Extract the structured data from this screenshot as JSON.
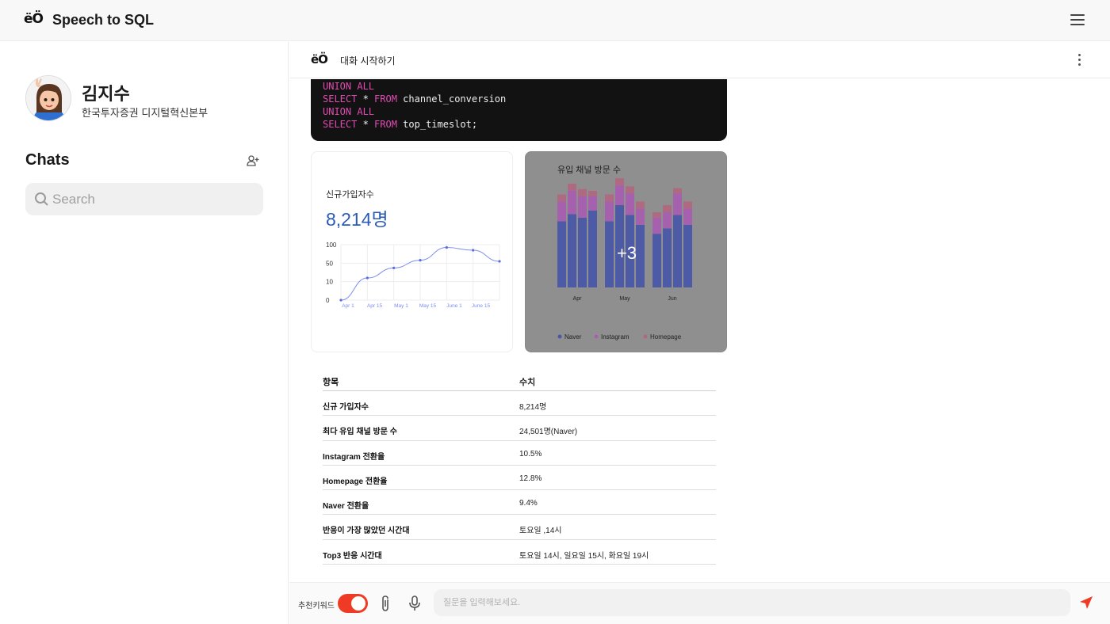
{
  "app": {
    "logo_text": "ëÖ",
    "title": "Speech to SQL"
  },
  "user": {
    "name": "김지수",
    "org": "한국투자증권 디지털혁신본부"
  },
  "sidebar": {
    "chats_title": "Chats",
    "search_placeholder": "Search"
  },
  "chat": {
    "header_label": "대화 시작하기"
  },
  "code": {
    "lines": [
      {
        "kw": "UNION ALL",
        "rest": ""
      },
      {
        "kw": "SELECT",
        "rest": " * ",
        "kw2": "FROM",
        "rest2": " channel_conversion"
      },
      {
        "kw": "UNION ALL",
        "rest": ""
      },
      {
        "kw": "SELECT",
        "rest": " * ",
        "kw2": "FROM",
        "rest2": " top_timeslot;"
      }
    ]
  },
  "card1": {
    "title": "신규가입자수",
    "value": "8,214명",
    "chart_data": {
      "type": "line",
      "x": [
        "Apr 1",
        "Apr 15",
        "May 1",
        "May 15",
        "June 1",
        "June 15"
      ],
      "y_ticks": [
        "100",
        "50",
        "10",
        "0"
      ],
      "values": [
        0,
        40,
        58,
        72,
        95,
        90,
        70
      ],
      "color": "#7d8ff0"
    }
  },
  "card2": {
    "title": "유입 채널 방문 수",
    "overlay": "+3",
    "chart_data": {
      "type": "bar",
      "stacked": true,
      "groups": [
        "Apr",
        "May",
        "Jun"
      ],
      "series": [
        {
          "name": "Naver",
          "color": "#4a58a8",
          "values": [
            74,
            82,
            78,
            86,
            74,
            92,
            81,
            70,
            60,
            66,
            81,
            70
          ]
        },
        {
          "name": "Instagram",
          "color": "#a85fb0",
          "values": [
            22,
            26,
            24,
            16,
            22,
            22,
            24,
            18,
            18,
            18,
            24,
            18
          ]
        },
        {
          "name": "Homepage",
          "color": "#b06880",
          "values": [
            8,
            8,
            8,
            6,
            8,
            8,
            8,
            8,
            6,
            8,
            6,
            8
          ]
        }
      ]
    }
  },
  "table": {
    "headers": [
      "항목",
      "수치"
    ],
    "rows": [
      [
        "신규 가입자수",
        "8,214명"
      ],
      [
        "최다 유입 채널 방문 수",
        "24,501명(Naver)"
      ],
      [
        "Instagram 전환율",
        "10.5%"
      ],
      [
        "Homepage 전환율",
        "12.8%"
      ],
      [
        "Naver 전환율",
        "9.4%"
      ],
      [
        "반응이 가장 많았던 시간대",
        "토요일 ,14시"
      ],
      [
        "Top3 반응 시간대",
        "토요일 14시, 일요일 15시, 화요일 19시"
      ]
    ]
  },
  "composer": {
    "keyword_label": "추천키워드",
    "placeholder": "질문을 입력해보세요.",
    "toggle_on": true
  },
  "colors": {
    "accent": "#ef3b25",
    "value_blue": "#2a5bb5"
  }
}
